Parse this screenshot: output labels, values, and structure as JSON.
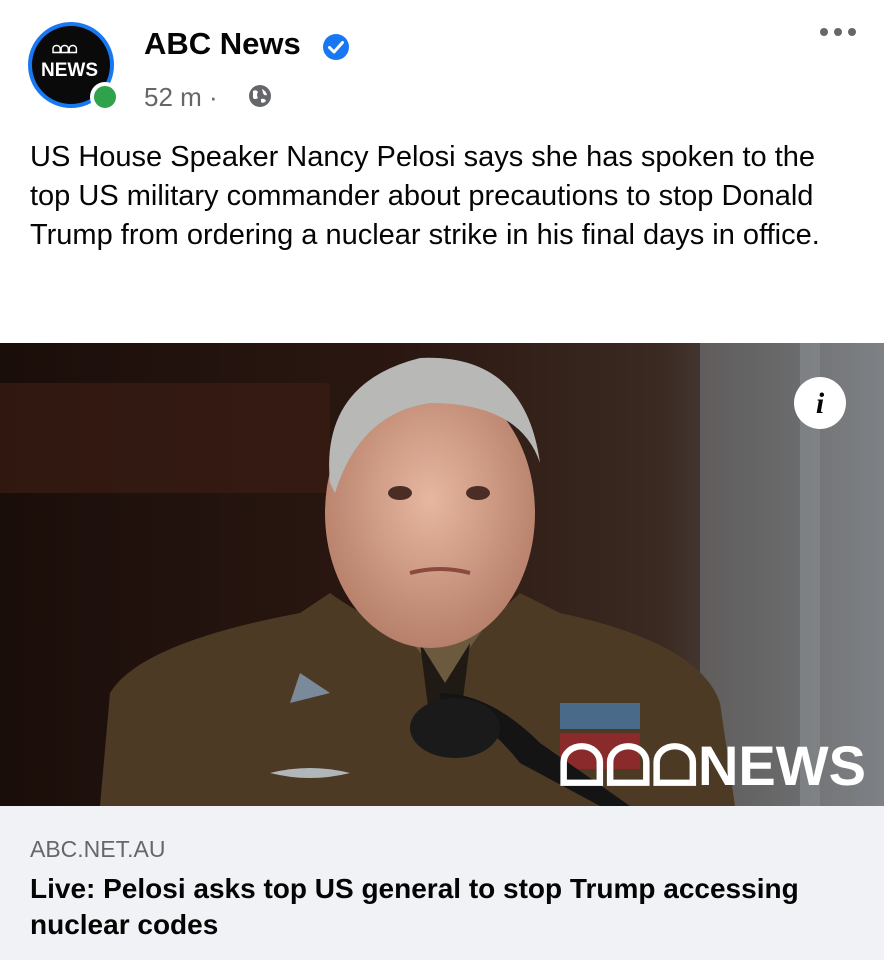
{
  "post": {
    "page_name": "ABC News",
    "avatar_mark": "ᗝᗝᗝ",
    "avatar_text": "NEWS",
    "time": "52 m ·",
    "caption": "US House Speaker Nancy Pelosi says she has spoken to the top US military commander about precautions to stop Donald Trump from ordering a nuclear strike in his final days in office.",
    "icons": [
      "verified-badge-icon",
      "globe-icon",
      "more-options-icon",
      "info-icon"
    ],
    "colors": {
      "verified": "#1877f2",
      "online": "#31a24c",
      "secondary_text": "#65676b",
      "preview_bg": "#f0f2f5"
    }
  },
  "image": {
    "watermark": "ᗝᗝᗝNEWS",
    "info_symbol": "i"
  },
  "link": {
    "domain": "ABC.NET.AU",
    "headline": "Live: Pelosi asks top US general to stop Trump accessing nuclear codes"
  }
}
